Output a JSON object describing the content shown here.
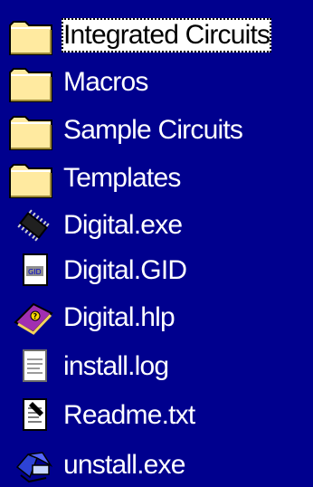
{
  "items": [
    {
      "label": "Integrated Circuits",
      "icon": "folder-icon",
      "selected": true
    },
    {
      "label": "Macros",
      "icon": "folder-icon"
    },
    {
      "label": "Sample Circuits",
      "icon": "folder-icon"
    },
    {
      "label": "Templates",
      "icon": "folder-icon"
    },
    {
      "label": "Digital.exe",
      "icon": "chip-app-icon"
    },
    {
      "label": "Digital.GID",
      "icon": "gid-file-icon"
    },
    {
      "label": "Digital.hlp",
      "icon": "help-book-icon"
    },
    {
      "label": "install.log",
      "icon": "text-document-icon"
    },
    {
      "label": "Readme.txt",
      "icon": "notepad-document-icon"
    },
    {
      "label": "unstall.exe",
      "icon": "uninstall-app-icon"
    }
  ],
  "colors": {
    "background": "#00008e",
    "folder": "#ffeaa0",
    "selection_bg": "#ffffff"
  }
}
